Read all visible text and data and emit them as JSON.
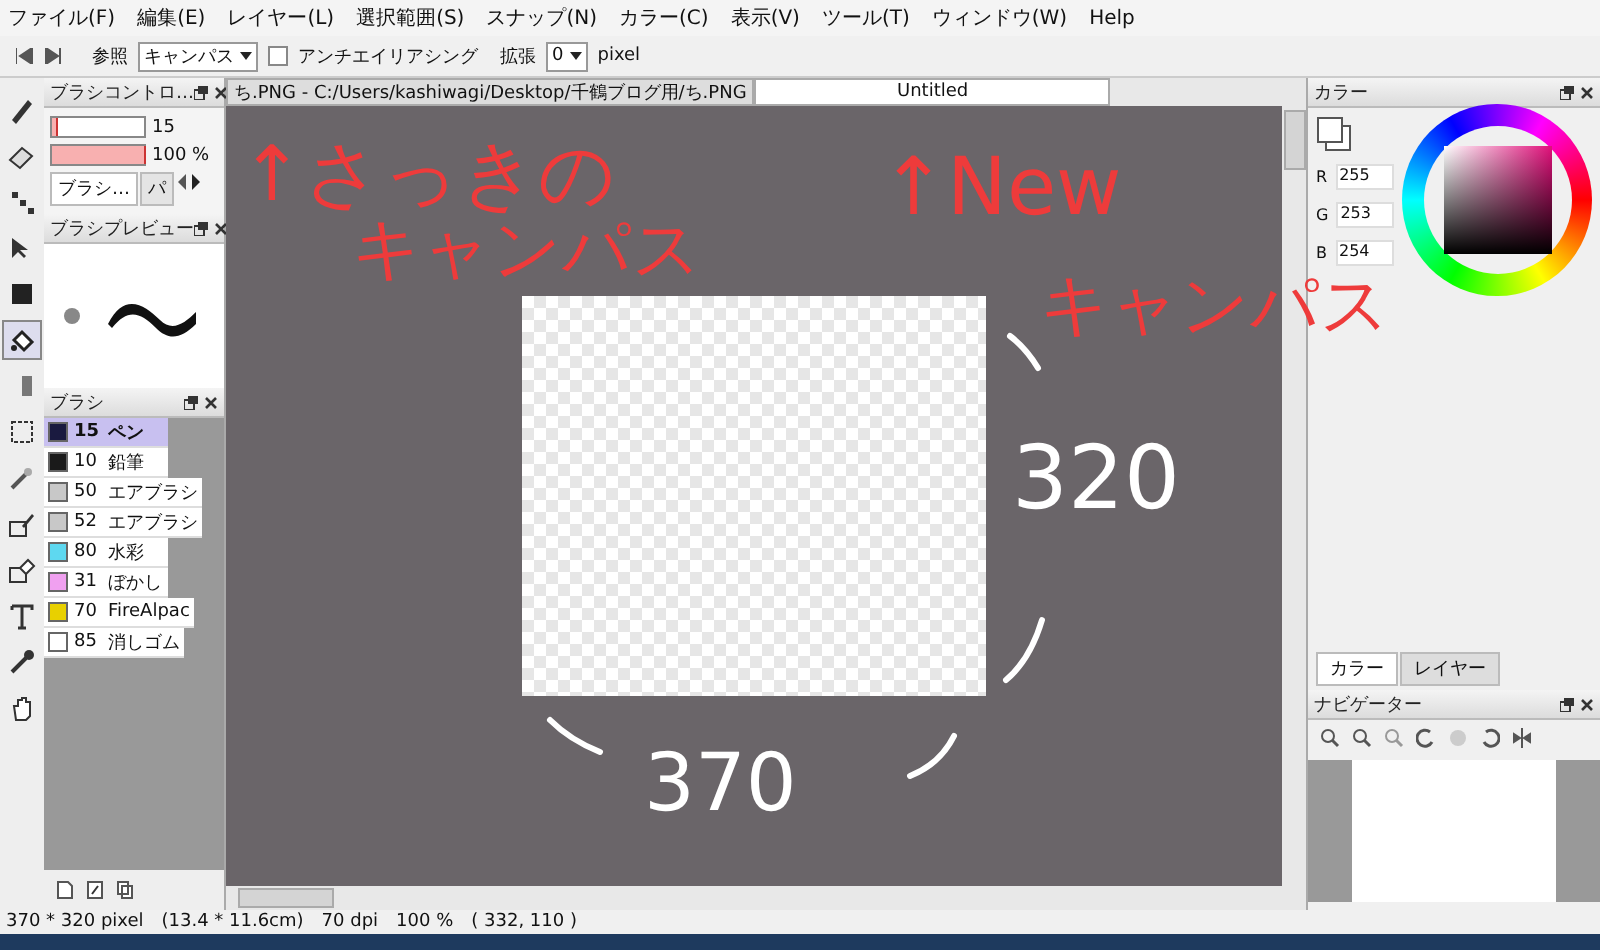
{
  "menu": [
    "ファイル(F)",
    "編集(E)",
    "レイヤー(L)",
    "選択範囲(S)",
    "スナップ(N)",
    "カラー(C)",
    "表示(V)",
    "ツール(T)",
    "ウィンドウ(W)",
    "Help"
  ],
  "toolbar": {
    "reference_label": "参照",
    "reference_value": "キャンパス",
    "antialias_label": "アンチエイリアシング",
    "antialias_checked": false,
    "expand_label": "拡張",
    "expand_value": "0",
    "expand_unit": "pixel"
  },
  "tools": [
    {
      "kind": "pen",
      "selected": false
    },
    {
      "kind": "eraser",
      "selected": false
    },
    {
      "kind": "dots",
      "selected": false
    },
    {
      "kind": "move",
      "selected": false
    },
    {
      "kind": "fill",
      "selected": false
    },
    {
      "kind": "bucket",
      "selected": true
    },
    {
      "kind": "gradient",
      "selected": false
    },
    {
      "kind": "select",
      "selected": false
    },
    {
      "kind": "wand",
      "selected": false
    },
    {
      "kind": "selpen",
      "selected": false
    },
    {
      "kind": "selerase",
      "selected": false
    },
    {
      "kind": "text",
      "selected": false
    },
    {
      "kind": "dropper",
      "selected": false
    },
    {
      "kind": "hand",
      "selected": false
    }
  ],
  "brush_control": {
    "title": "ブラシコントロ…",
    "size": {
      "level": 0.05,
      "reading": "15"
    },
    "opacity": {
      "level": 1,
      "reading": "100 %"
    },
    "tabs": [
      {
        "label": "ブラシ…",
        "selected": true
      },
      {
        "label": "パ",
        "selected": false
      }
    ]
  },
  "brush_preview": {
    "title": "ブラシプレビュー"
  },
  "brushes": {
    "title": "ブラシ",
    "items": [
      {
        "size": "15",
        "name": "ペン",
        "color": "#1a1a40",
        "selected": true
      },
      {
        "size": "10",
        "name": "鉛筆",
        "color": "#1a1a1a",
        "selected": false
      },
      {
        "size": "50",
        "name": "エアブラシ",
        "color": "#c8c8c8",
        "selected": false
      },
      {
        "size": "52",
        "name": "エアブラシ",
        "color": "#c8c8c8",
        "selected": false
      },
      {
        "size": "80",
        "name": "水彩",
        "color": "#5ed8f0",
        "selected": false
      },
      {
        "size": "31",
        "name": "ぼかし",
        "color": "#f0a0f0",
        "selected": false
      },
      {
        "size": "70",
        "name": "FireAlpac",
        "color": "#e8d000",
        "selected": false
      },
      {
        "size": "85",
        "name": "消しゴム",
        "color": "#ffffff",
        "selected": false
      }
    ]
  },
  "documents": [
    {
      "title": "ち.PNG - C:/Users/kashiwagi/Desktop/千鶴ブログ用/ち.PNG",
      "selected": false
    },
    {
      "title": "Untitled",
      "selected": true
    }
  ],
  "annotations": [
    {
      "kind": "red",
      "text": "↑さっきの"
    },
    {
      "kind": "red",
      "text": "キャンパス"
    },
    {
      "kind": "red",
      "text": "↑New"
    },
    {
      "kind": "red",
      "text": "キャンパス"
    },
    {
      "kind": "white",
      "text": "320"
    },
    {
      "kind": "white",
      "text": "370"
    }
  ],
  "color_panel": {
    "title": "カラー",
    "fields": [
      {
        "label": "R",
        "value": "255"
      },
      {
        "label": "G",
        "value": "253"
      },
      {
        "label": "B",
        "value": "254"
      }
    ],
    "tabs": [
      {
        "label": "カラー",
        "selected": true
      },
      {
        "label": "レイヤー",
        "selected": false
      }
    ]
  },
  "navigator": {
    "title": "ナビゲーター"
  },
  "status_bar": [
    "370 * 320 pixel",
    "(13.4 * 11.6cm)",
    "70 dpi",
    "100 %",
    "( 332, 110 )"
  ]
}
